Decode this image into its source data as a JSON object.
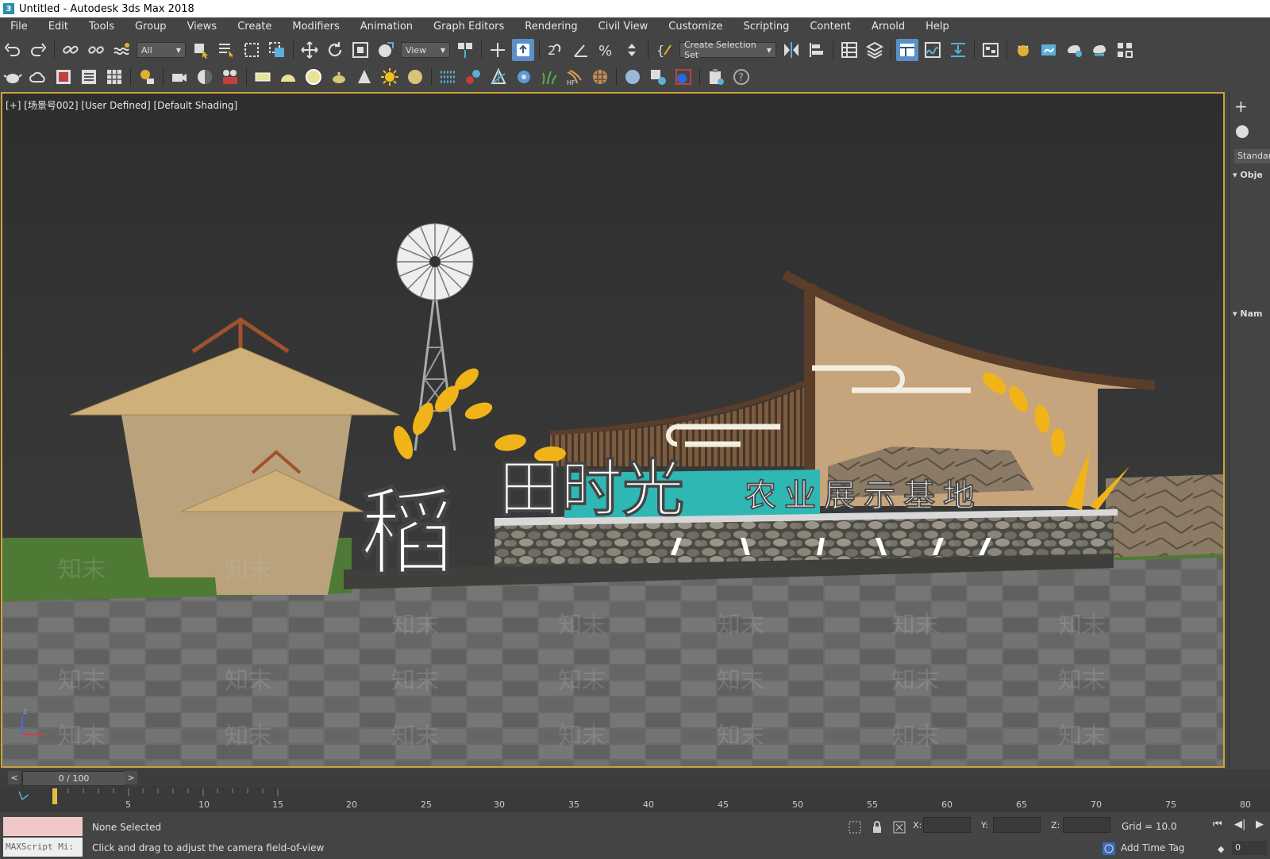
{
  "window": {
    "title": "Untitled - Autodesk 3ds Max 2018",
    "app_icon": "3"
  },
  "menu": [
    "File",
    "Edit",
    "Tools",
    "Group",
    "Views",
    "Create",
    "Modifiers",
    "Animation",
    "Graph Editors",
    "Rendering",
    "Civil View",
    "Customize",
    "Scripting",
    "Content",
    "Arnold",
    "Help"
  ],
  "toolbar": {
    "selection_filter": "All",
    "ref_coord": "View",
    "selection_set": "Create Selection Set"
  },
  "viewport": {
    "label": "[+] [场景号002] [User Defined] [Default Shading]",
    "scene_title_big": "稻田时光",
    "scene_title_small": "农业展示基地",
    "watermark": "知末",
    "frame_color": "#c9a43a"
  },
  "command_panel": {
    "category": "Standard",
    "rollout_object": "Obje",
    "rollout_name": "Nam"
  },
  "timeline": {
    "frame_display": "0 / 100",
    "prev": "<",
    "next": ">",
    "ticks": [
      "5",
      "10",
      "15",
      "20",
      "25",
      "30",
      "35",
      "40",
      "45",
      "50",
      "55",
      "60",
      "65",
      "70",
      "75",
      "80"
    ]
  },
  "status": {
    "maxscript": "MAXScript Mi:",
    "selection": "None Selected",
    "prompt": "Click and drag to adjust the camera field-of-view",
    "x_label": "X:",
    "y_label": "Y:",
    "z_label": "Z:",
    "grid": "Grid = 10.0",
    "add_time_tag": "Add Time Tag",
    "frame_field": "0"
  }
}
